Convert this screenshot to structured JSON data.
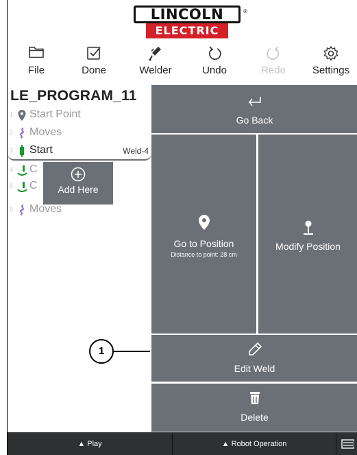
{
  "brand": {
    "line1": "LINCOLN",
    "line2": "ELECTRIC",
    "reg": "®"
  },
  "toolbar": [
    {
      "label": "File",
      "icon": "folder-icon",
      "enabled": true
    },
    {
      "label": "Done",
      "icon": "check-square-icon",
      "enabled": true
    },
    {
      "label": "Welder",
      "icon": "welder-icon",
      "enabled": true
    },
    {
      "label": "Undo",
      "icon": "undo-icon",
      "enabled": true
    },
    {
      "label": "Redo",
      "icon": "redo-icon",
      "enabled": false
    },
    {
      "label": "Settings",
      "icon": "gear-icon",
      "enabled": true
    }
  ],
  "program": {
    "title": "LE_PROGRAM_11",
    "rows": [
      {
        "num": "1",
        "label": "Start Point",
        "icon": "location-pin-icon",
        "tag": ""
      },
      {
        "num": "2",
        "label": "Moves",
        "icon": "moves-icon",
        "tag": ""
      },
      {
        "num": "3",
        "label": "Start",
        "icon": "weld-torch-icon",
        "tag": "Weld-4"
      },
      {
        "num": "4",
        "label": "C",
        "icon": "weld-arc-icon",
        "tag": ""
      },
      {
        "num": "5",
        "label": "C",
        "icon": "weld-arc-icon",
        "tag": ""
      },
      {
        "num": "6",
        "label": "Moves",
        "icon": "moves-icon",
        "tag": ""
      }
    ],
    "add_here": "Add Here"
  },
  "actions": {
    "go_back": "Go Back",
    "go_to_position": "Go to Position",
    "distance": "Distance to point: 28 cm",
    "modify_position": "Modify Position",
    "edit_weld": "Edit Weld",
    "delete": "Delete"
  },
  "bottom_bar": {
    "play": "▲ Play",
    "robot_operation": "▲ Robot Operation"
  },
  "callout": "1",
  "colors": {
    "tile": "#6b7077",
    "moves_icon": "#8c6fd6",
    "pin_icon": "#6b7077",
    "torch_icon": "#1a9a2a",
    "brand_red": "#d42129"
  }
}
